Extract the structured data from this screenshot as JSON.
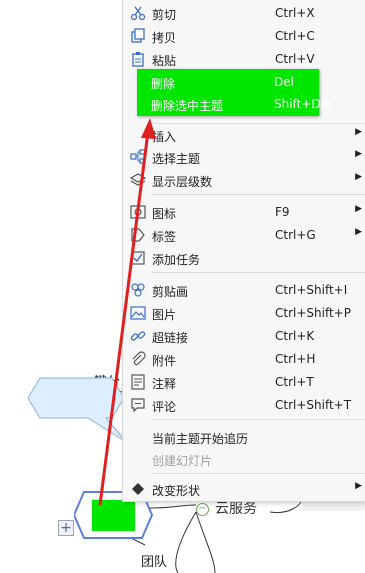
{
  "menu": {
    "items": [
      {
        "label": "剪切",
        "shortcut": "Ctrl+X",
        "icon": "scissors-icon"
      },
      {
        "label": "拷贝",
        "shortcut": "Ctrl+C",
        "icon": "copy-icon"
      },
      {
        "label": "粘贴",
        "shortcut": "Ctrl+V",
        "icon": "clipboard-icon"
      },
      {
        "label": "删除",
        "shortcut": "Del"
      },
      {
        "label": "删除选中主题",
        "shortcut": "Shift+Del"
      },
      {
        "label": "插入",
        "submenu": true
      },
      {
        "label": "选择主题",
        "submenu": true,
        "icon": "select-topic-icon"
      },
      {
        "label": "显示层级数",
        "submenu": true,
        "icon": "layers-icon"
      },
      {
        "label": "图标",
        "shortcut": "F9",
        "submenu": true,
        "icon": "image-icon"
      },
      {
        "label": "标签",
        "shortcut": "Ctrl+G",
        "submenu": true,
        "icon": "tag-icon"
      },
      {
        "label": "添加任务",
        "icon": "task-icon"
      },
      {
        "label": "剪贴画",
        "shortcut": "Ctrl+Shift+I",
        "icon": "clipart-icon"
      },
      {
        "label": "图片",
        "shortcut": "Ctrl+Shift+P",
        "icon": "picture-icon"
      },
      {
        "label": "超链接",
        "shortcut": "Ctrl+K",
        "icon": "link-icon"
      },
      {
        "label": "附件",
        "shortcut": "Ctrl+H",
        "icon": "paperclip-icon"
      },
      {
        "label": "注释",
        "shortcut": "Ctrl+T",
        "icon": "note-icon"
      },
      {
        "label": "评论",
        "shortcut": "Ctrl+Shift+T",
        "icon": "comment-icon"
      },
      {
        "label": "当前主题开始追历"
      },
      {
        "label": "创建幻灯片",
        "disabled": true
      },
      {
        "label": "改变形状",
        "submenu": true,
        "icon": "diamond-icon"
      }
    ],
    "submenu_arrow": "▶"
  },
  "canvas": {
    "left_topic": "一键分",
    "cloud_node": "云服务",
    "team_node": "团队",
    "plus_symbol": "+",
    "collapse_symbol": "−"
  },
  "colors": {
    "highlight": "#00e600",
    "arrow": "#e02020",
    "selection_border": "#5b7fe0",
    "topic_fill": "#00e600"
  }
}
